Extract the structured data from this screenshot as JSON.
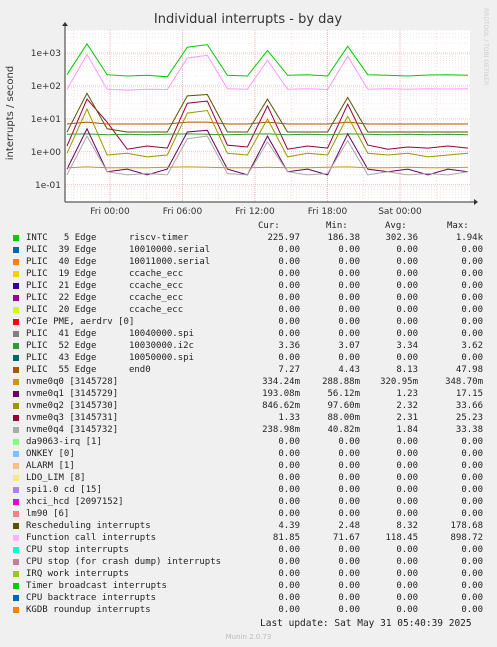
{
  "title": "Individual interrupts - by day",
  "side_label": "RRDTOOL / TOBI OETIKER",
  "chart_data": {
    "type": "line",
    "title": "Individual interrupts - by day",
    "ylabel": "interrupts / second",
    "yscale": "log",
    "ylim": [
      0.03,
      5000
    ],
    "y_ticks": [
      {
        "value": 0.1,
        "label": "1e-01"
      },
      {
        "value": 1,
        "label": "1e+00"
      },
      {
        "value": 10,
        "label": "1e+01"
      },
      {
        "value": 100,
        "label": "1e+02"
      },
      {
        "value": 1000,
        "label": "1e+03"
      }
    ],
    "x_ticks": [
      "Fri 00:00",
      "Fri 06:00",
      "Fri 12:00",
      "Fri 18:00",
      "Sat 00:00"
    ],
    "grid": true,
    "series": [
      {
        "name": "INTC 5 Edge riscv-timer",
        "color": "#00cc00",
        "values": [
          220,
          1900,
          220,
          200,
          210,
          190,
          1500,
          1800,
          210,
          200,
          1200,
          210,
          220,
          200,
          1600,
          220,
          210,
          200,
          215,
          220,
          210
        ]
      },
      {
        "name": "Function call interrupts",
        "color": "#ff99ff",
        "values": [
          80,
          900,
          80,
          75,
          80,
          78,
          700,
          850,
          82,
          80,
          600,
          80,
          82,
          78,
          800,
          80,
          82,
          80,
          82,
          81,
          82
        ]
      },
      {
        "name": "nvme0q3 [3145731]",
        "color": "#990033",
        "values": [
          1.5,
          40,
          8,
          1.2,
          1.5,
          1.3,
          30,
          35,
          1.6,
          1.4,
          25,
          1.2,
          1.5,
          1.3,
          28,
          1.6,
          1.2,
          1.4,
          1.3,
          1.5,
          1.3
        ]
      },
      {
        "name": "Rescheduling interrupts",
        "color": "#555500",
        "values": [
          4,
          60,
          5,
          4,
          4,
          4,
          50,
          55,
          4,
          4,
          40,
          4,
          4,
          4,
          45,
          4,
          4,
          4,
          4,
          4,
          4
        ]
      },
      {
        "name": "PLIC 55 Edge end0",
        "color": "#aa5500",
        "values": [
          7,
          8,
          7,
          7,
          7,
          7,
          8,
          8,
          7,
          7,
          8,
          7,
          7,
          7,
          8,
          7,
          7,
          7,
          7,
          7,
          7
        ]
      },
      {
        "name": "PLIC 52 Edge 10030000.i2c",
        "color": "#339933",
        "values": [
          3.4,
          3.5,
          3.3,
          3.4,
          3.3,
          3.4,
          3.5,
          3.4,
          3.3,
          3.4,
          3.5,
          3.3,
          3.4,
          3.3,
          3.5,
          3.4,
          3.3,
          3.4,
          3.3,
          3.4,
          3.3
        ]
      },
      {
        "name": "nvme0q2 [3145730]",
        "color": "#999900",
        "values": [
          0.9,
          20,
          0.8,
          0.9,
          0.7,
          0.8,
          15,
          18,
          0.9,
          0.8,
          10,
          0.7,
          0.9,
          0.8,
          12,
          0.9,
          0.8,
          0.9,
          0.7,
          0.8,
          0.9
        ]
      },
      {
        "name": "nvme0q1 [3145729]",
        "color": "#660066",
        "values": [
          0.3,
          5,
          0.25,
          0.3,
          0.2,
          0.3,
          4,
          4.5,
          0.3,
          0.2,
          3,
          0.25,
          0.3,
          0.2,
          3.5,
          0.3,
          0.25,
          0.3,
          0.2,
          0.3,
          0.25
        ]
      },
      {
        "name": "nvme0q4 [3145732]",
        "color": "#aaaaaa",
        "values": [
          0.2,
          3,
          0.25,
          0.2,
          0.22,
          0.2,
          2.5,
          3,
          0.22,
          0.2,
          2,
          0.25,
          0.2,
          0.22,
          2.2,
          0.2,
          0.25,
          0.2,
          0.22,
          0.2,
          0.25
        ]
      },
      {
        "name": "nvme0q0 [3145728]",
        "color": "#cc9900",
        "values": [
          0.33,
          0.35,
          0.33,
          0.33,
          0.33,
          0.34,
          0.35,
          0.34,
          0.33,
          0.33,
          0.34,
          0.33,
          0.33,
          0.34,
          0.35,
          0.33,
          0.33,
          0.34,
          0.33,
          0.33,
          0.34
        ]
      }
    ]
  },
  "legend": {
    "headers": {
      "cur": "Cur:",
      "min": "Min:",
      "avg": "Avg:",
      "max": "Max:"
    },
    "rows": [
      {
        "label": "INTC   5 Edge      riscv-timer",
        "color": "#00cc00",
        "cur": "225.97",
        "min": "186.38",
        "avg": "302.36",
        "max": "1.94k"
      },
      {
        "label": "PLIC  39 Edge      10010000.serial",
        "color": "#0066b3",
        "cur": "0.00",
        "min": "0.00",
        "avg": "0.00",
        "max": "0.00"
      },
      {
        "label": "PLIC  40 Edge      10011000.serial",
        "color": "#ff8000",
        "cur": "0.00",
        "min": "0.00",
        "avg": "0.00",
        "max": "0.00"
      },
      {
        "label": "PLIC  19 Edge      ccache_ecc",
        "color": "#ffcc00",
        "cur": "0.00",
        "min": "0.00",
        "avg": "0.00",
        "max": "0.00"
      },
      {
        "label": "PLIC  21 Edge      ccache_ecc",
        "color": "#330099",
        "cur": "0.00",
        "min": "0.00",
        "avg": "0.00",
        "max": "0.00"
      },
      {
        "label": "PLIC  22 Edge      ccache_ecc",
        "color": "#990099",
        "cur": "0.00",
        "min": "0.00",
        "avg": "0.00",
        "max": "0.00"
      },
      {
        "label": "PLIC  20 Edge      ccache_ecc",
        "color": "#ccff00",
        "cur": "0.00",
        "min": "0.00",
        "avg": "0.00",
        "max": "0.00"
      },
      {
        "label": "PCIe PME, aerdrv [0]",
        "color": "#ff0000",
        "cur": "0.00",
        "min": "0.00",
        "avg": "0.00",
        "max": "0.00"
      },
      {
        "label": "PLIC  41 Edge      10040000.spi",
        "color": "#808080",
        "cur": "0.00",
        "min": "0.00",
        "avg": "0.00",
        "max": "0.00"
      },
      {
        "label": "PLIC  52 Edge      10030000.i2c",
        "color": "#339933",
        "cur": "3.36",
        "min": "3.07",
        "avg": "3.34",
        "max": "3.62"
      },
      {
        "label": "PLIC  43 Edge      10050000.spi",
        "color": "#006666",
        "cur": "0.00",
        "min": "0.00",
        "avg": "0.00",
        "max": "0.00"
      },
      {
        "label": "PLIC  55 Edge      end0",
        "color": "#aa5500",
        "cur": "7.27",
        "min": "4.43",
        "avg": "8.13",
        "max": "47.98"
      },
      {
        "label": "nvme0q0 [3145728]",
        "color": "#cc9900",
        "cur": "334.24m",
        "min": "288.88m",
        "avg": "320.95m",
        "max": "348.70m"
      },
      {
        "label": "nvme0q1 [3145729]",
        "color": "#660066",
        "cur": "193.08m",
        "min": "56.12m",
        "avg": "1.23",
        "max": "17.15"
      },
      {
        "label": "nvme0q2 [3145730]",
        "color": "#999900",
        "cur": "846.62m",
        "min": "97.60m",
        "avg": "2.32",
        "max": "33.66"
      },
      {
        "label": "nvme0q3 [3145731]",
        "color": "#990033",
        "cur": "1.33",
        "min": "88.00m",
        "avg": "2.31",
        "max": "25.23"
      },
      {
        "label": "nvme0q4 [3145732]",
        "color": "#aaaaaa",
        "cur": "238.98m",
        "min": "40.82m",
        "avg": "1.84",
        "max": "33.38"
      },
      {
        "label": "da9063-irq [1]",
        "color": "#80ff80",
        "cur": "0.00",
        "min": "0.00",
        "avg": "0.00",
        "max": "0.00"
      },
      {
        "label": "ONKEY [0]",
        "color": "#80c0ff",
        "cur": "0.00",
        "min": "0.00",
        "avg": "0.00",
        "max": "0.00"
      },
      {
        "label": "ALARM [1]",
        "color": "#ffc080",
        "cur": "0.00",
        "min": "0.00",
        "avg": "0.00",
        "max": "0.00"
      },
      {
        "label": "LDO_LIM [8]",
        "color": "#ffe680",
        "cur": "0.00",
        "min": "0.00",
        "avg": "0.00",
        "max": "0.00"
      },
      {
        "label": "spi1.0 cd [15]",
        "color": "#aa80ff",
        "cur": "0.00",
        "min": "0.00",
        "avg": "0.00",
        "max": "0.00"
      },
      {
        "label": "xhci_hcd [2097152]",
        "color": "#ee00cc",
        "cur": "0.00",
        "min": "0.00",
        "avg": "0.00",
        "max": "0.00"
      },
      {
        "label": "lm90 [6]",
        "color": "#ff8080",
        "cur": "0.00",
        "min": "0.00",
        "avg": "0.00",
        "max": "0.00"
      },
      {
        "label": "Rescheduling interrupts",
        "color": "#555500",
        "cur": "4.39",
        "min": "2.48",
        "avg": "8.32",
        "max": "178.68"
      },
      {
        "label": "Function call interrupts",
        "color": "#ffb3ff",
        "cur": "81.85",
        "min": "71.67",
        "avg": "118.45",
        "max": "898.72"
      },
      {
        "label": "CPU stop interrupts",
        "color": "#00ffcc",
        "cur": "0.00",
        "min": "0.00",
        "avg": "0.00",
        "max": "0.00"
      },
      {
        "label": "CPU stop (for crash dump) interrupts",
        "color": "#c080a0",
        "cur": "0.00",
        "min": "0.00",
        "avg": "0.00",
        "max": "0.00"
      },
      {
        "label": "IRQ work interrupts",
        "color": "#99cc00",
        "cur": "0.00",
        "min": "0.00",
        "avg": "0.00",
        "max": "0.00"
      },
      {
        "label": "Timer broadcast interrupts",
        "color": "#00cc00",
        "cur": "0.00",
        "min": "0.00",
        "avg": "0.00",
        "max": "0.00"
      },
      {
        "label": "CPU backtrace interrupts",
        "color": "#0066b3",
        "cur": "0.00",
        "min": "0.00",
        "avg": "0.00",
        "max": "0.00"
      },
      {
        "label": "KGDB roundup interrupts",
        "color": "#ff8000",
        "cur": "0.00",
        "min": "0.00",
        "avg": "0.00",
        "max": "0.00"
      }
    ]
  },
  "footer": {
    "last_update": "Last update: Sat May 31 05:40:39 2025",
    "munin": "Munin 2.0.73"
  }
}
